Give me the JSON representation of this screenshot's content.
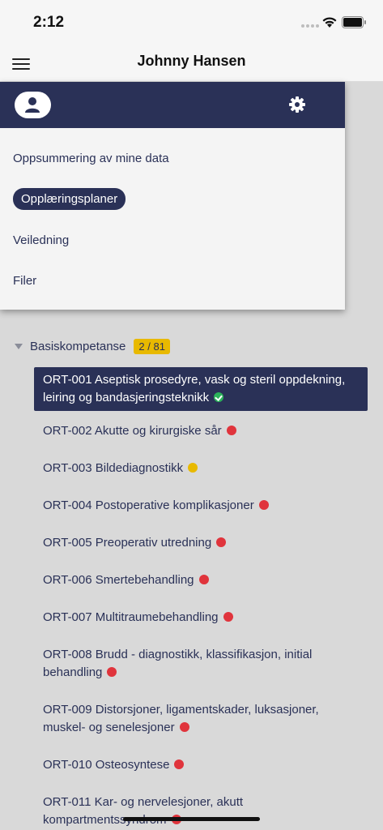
{
  "status": {
    "time": "2:12"
  },
  "header": {
    "title": "Johnny Hansen"
  },
  "drawer": {
    "items": [
      {
        "label": "Oppsummering av mine data"
      },
      {
        "label": "Opplæringsplaner"
      },
      {
        "label": "Veiledning"
      },
      {
        "label": "Filer"
      }
    ]
  },
  "group": {
    "label": "Basiskompetanse",
    "count": "2 / 81"
  },
  "plans": [
    {
      "title": "ORT-001 Aseptisk prosedyre, vask og steril oppdekning, leiring og bandasjeringsteknikk",
      "status": "green"
    },
    {
      "title": "ORT-002 Akutte og kirurgiske sår",
      "status": "red"
    },
    {
      "title": "ORT-003 Bildediagnostikk",
      "status": "yellow"
    },
    {
      "title": "ORT-004 Postoperative komplikasjoner",
      "status": "red"
    },
    {
      "title": "ORT-005 Preoperativ utredning",
      "status": "red"
    },
    {
      "title": "ORT-006 Smertebehandling",
      "status": "red"
    },
    {
      "title": "ORT-007 Multitraumebehandling",
      "status": "red"
    },
    {
      "title": "ORT-008 Brudd - diagnostikk, klassifikasjon, initial behandling",
      "status": "red"
    },
    {
      "title": "ORT-009 Distorsjoner, ligamentskader, luksasjoner, muskel- og senelesjoner",
      "status": "red"
    },
    {
      "title": "ORT-010 Osteosyntese",
      "status": "red"
    },
    {
      "title": "ORT-011 Kar- og nervelesjoner, akutt kompartmentssyndrom",
      "status": "red"
    }
  ],
  "colors": {
    "navy": "#2a3157",
    "red": "#e0343c",
    "yellow": "#e8b900",
    "green": "#2bb35a"
  }
}
